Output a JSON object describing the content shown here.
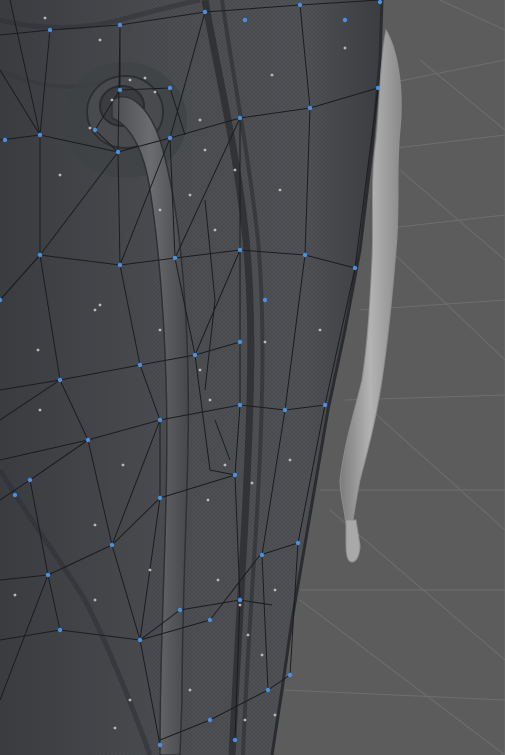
{
  "viewport": {
    "background_color": "#5c5c5c",
    "grid_color": "#6e6e6e"
  },
  "model": {
    "mesh_color": "#4a4c50",
    "mesh_shadow_color": "#34363a",
    "wireframe_color": "#1a1c20",
    "vertex_color": "#4a90e2",
    "highlight_dot_color": "#b9b9b9",
    "sculpt_detail_color": "#a6a6a6"
  }
}
